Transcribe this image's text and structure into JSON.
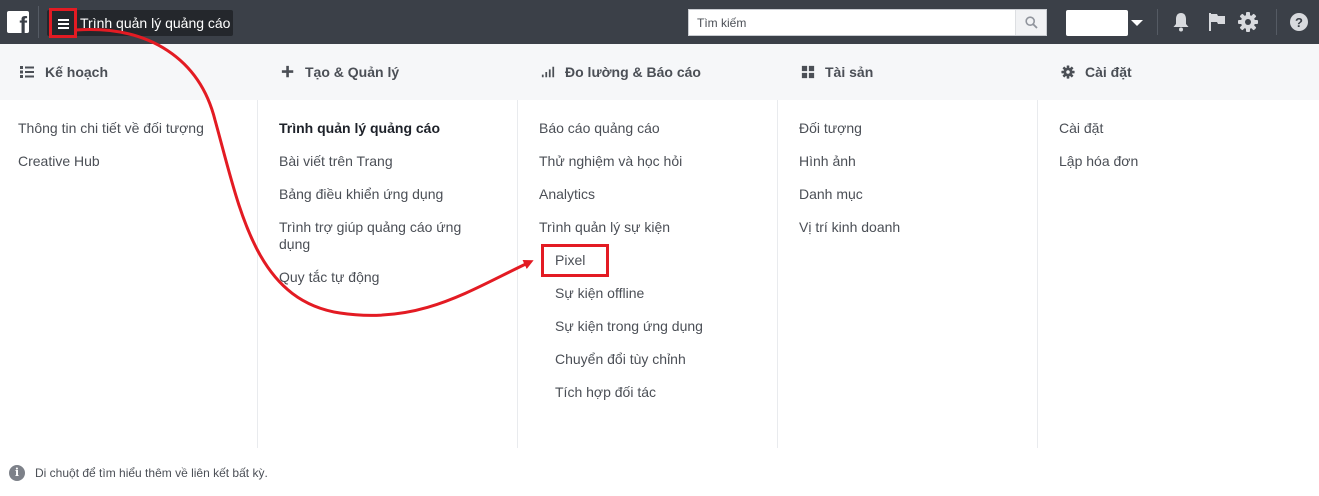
{
  "topbar": {
    "app_title": "Trình quản lý quảng cáo",
    "search_placeholder": "Tìm kiếm"
  },
  "columns": [
    {
      "icon": "list-icon",
      "heading": "Kế hoạch",
      "items": [
        "Thông tin chi tiết về đối tượng",
        "Creative Hub"
      ]
    },
    {
      "icon": "plus-icon",
      "heading": "Tạo & Quản lý",
      "items": [
        "Trình quản lý quảng cáo",
        "Bài viết trên Trang",
        "Bảng điều khiển ứng dụng",
        "Trình trợ giúp quảng cáo ứng dụng",
        "Quy tắc tự động"
      ]
    },
    {
      "icon": "bar-chart-icon",
      "heading": "Đo lường & Báo cáo",
      "items": [
        "Báo cáo quảng cáo",
        "Thử nghiệm và học hỏi",
        "Analytics",
        "Trình quản lý sự kiện"
      ],
      "subitems": [
        "Pixel",
        "Sự kiện offline",
        "Sự kiện trong ứng dụng",
        "Chuyển đổi tùy chỉnh",
        "Tích hợp đối tác"
      ]
    },
    {
      "icon": "grid-icon",
      "heading": "Tài sản",
      "items": [
        "Đối tượng",
        "Hình ảnh",
        "Danh mục",
        "Vị trí kinh doanh"
      ]
    },
    {
      "icon": "gear-icon",
      "heading": "Cài đặt",
      "items": [
        "Cài đặt",
        "Lập hóa đơn"
      ]
    }
  ],
  "footer": {
    "hint": "Di chuột để tìm hiểu thêm về liên kết bất kỳ."
  },
  "colors": {
    "topbar": "#3b4048",
    "highlight": "#e31b23",
    "header_bg": "#f6f7f9"
  }
}
